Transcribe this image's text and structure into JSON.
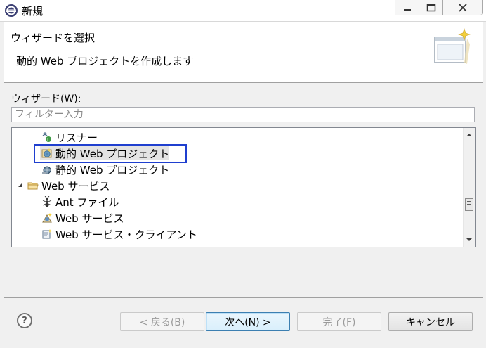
{
  "window": {
    "title": "新規"
  },
  "header": {
    "title": "ウィザードを選択",
    "description": "動的 Web プロジェクトを作成します"
  },
  "wizards": {
    "label": "ウィザード(W):",
    "filter_placeholder": "フィルター入力",
    "items": [
      {
        "label": "リスナー",
        "icon": "listener-icon"
      },
      {
        "label": "動的 Web プロジェクト",
        "icon": "dynamic-web-project-icon",
        "selected": true
      },
      {
        "label": "静的 Web プロジェクト",
        "icon": "static-web-project-icon"
      },
      {
        "label": "Web サービス",
        "icon": "folder-icon",
        "expanded": true
      },
      {
        "label": "Ant ファイル",
        "icon": "ant-file-icon"
      },
      {
        "label": "Web サービス",
        "icon": "web-service-icon"
      },
      {
        "label": "Web サービス・クライアント",
        "icon": "web-service-client-icon"
      }
    ]
  },
  "buttons": {
    "back": "< 戻る(B)",
    "next": "次へ(N) >",
    "finish": "完了(F)",
    "cancel": "キャンセル"
  },
  "help": {
    "symbol": "?"
  }
}
